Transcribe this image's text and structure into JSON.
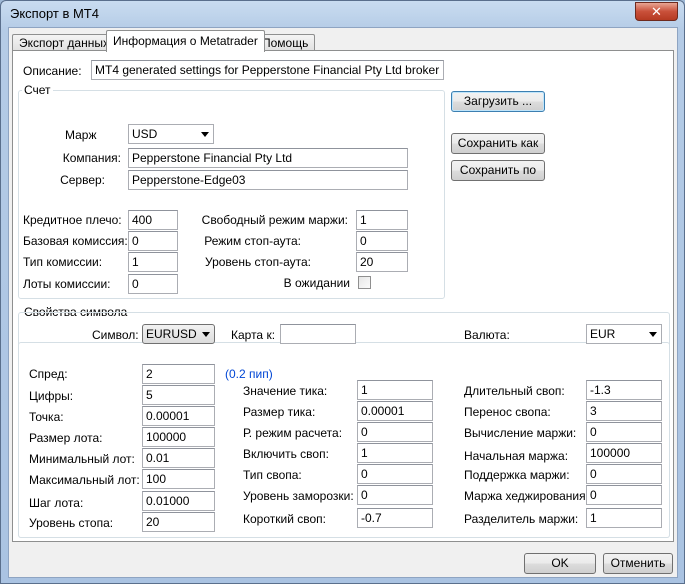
{
  "window": {
    "title": "Экспорт в MT4",
    "close_label": "✕"
  },
  "tabs": [
    {
      "label": "Экспорт данных",
      "active": false
    },
    {
      "label": "Информация о Metatrader",
      "active": true
    },
    {
      "label": "Помощь",
      "active": false
    }
  ],
  "description": {
    "label": "Описание:",
    "value": "MT4 generated settings for Pepperstone Financial Pty Ltd broker"
  },
  "account": {
    "group_title": "Счет",
    "currency_label": "Марж",
    "currency_value": "USD",
    "company_label": "Компания:",
    "company_value": "Pepperstone Financial Pty Ltd",
    "server_label": "Сервер:",
    "server_value": "Pepperstone-Edge03",
    "leverage_label": "Кредитное плечо:",
    "leverage_value": "400",
    "base_commission_label": "Базовая комиссия:",
    "base_commission_value": "0",
    "commission_type_label": "Тип комиссии:",
    "commission_type_value": "1",
    "commission_lots_label": "Лоты комиссии:",
    "commission_lots_value": "0",
    "free_margin_mode_label": "Свободный режим маржи:",
    "free_margin_mode_value": "1",
    "stopout_mode_label": "Режим стоп-аута:",
    "stopout_mode_value": "0",
    "stopout_level_label": "Уровень стоп-аута:",
    "stopout_level_value": "20",
    "pending_label": "В ожидании"
  },
  "actions": {
    "load": "Загрузить ...",
    "save_as": "Сохранить как",
    "save_default": "Сохранить по"
  },
  "symbol_props": {
    "group_title": "Свойства символа",
    "symbol_label": "Символ:",
    "symbol_value": "EURUSD",
    "map_label": "Карта к:",
    "map_value": "",
    "currency_label": "Валюта:",
    "currency_value": "EUR",
    "spread_label": "Спред:",
    "spread_value": "2",
    "spread_note": "(0.2 пип)",
    "digits_label": "Цифры:",
    "digits_value": "5",
    "point_label": "Точка:",
    "point_value": "0.00001",
    "lot_size_label": "Размер лота:",
    "lot_size_value": "100000",
    "min_lot_label": "Минимальный лот:",
    "min_lot_value": "0.01",
    "max_lot_label": "Максимальный лот:",
    "max_lot_value": "100",
    "lot_step_label": "Шаг лота:",
    "lot_step_value": "0.01000",
    "stop_level_label": "Уровень стопа:",
    "stop_level_value": "20",
    "tick_value_label": "Значение тика:",
    "tick_value_value": "1",
    "tick_size_label": "Размер тика:",
    "tick_size_value": "0.00001",
    "calc_mode_label": "Р. режим расчета:",
    "calc_mode_value": "0",
    "swap_enabled_label": "Включить своп:",
    "swap_enabled_value": "1",
    "swap_type_label": "Тип свопа:",
    "swap_type_value": "0",
    "freeze_level_label": "Уровень заморозки:",
    "freeze_level_value": "0",
    "short_swap_label": "Короткий своп:",
    "short_swap_value": "-0.7",
    "long_swap_label": "Длительный своп:",
    "long_swap_value": "-1.3",
    "swap_rollover_label": "Перенос свопа:",
    "swap_rollover_value": "3",
    "margin_calc_label": "Вычисление маржи:",
    "margin_calc_value": "0",
    "initial_margin_label": "Начальная маржа:",
    "initial_margin_value": "100000",
    "maintenance_margin_label": "Поддержка маржи:",
    "maintenance_margin_value": "0",
    "hedged_margin_label": "Маржа хеджирования:",
    "hedged_margin_value": "0",
    "margin_divider_label": "Разделитель маржи:",
    "margin_divider_value": "1"
  },
  "footer": {
    "ok": "OK",
    "cancel": "Отменить"
  }
}
